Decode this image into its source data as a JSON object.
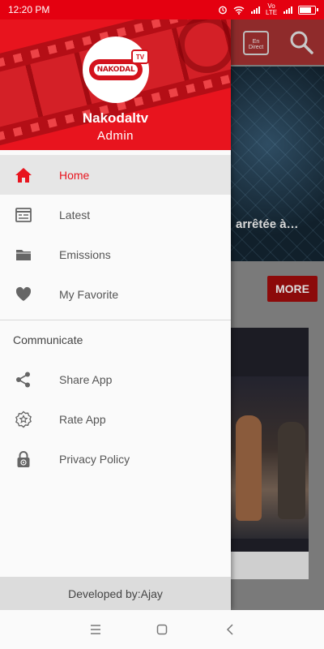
{
  "status_bar": {
    "time": "12:20 PM",
    "network_labels": "Vo LTE"
  },
  "drawer": {
    "header": {
      "logo_text": "NAKODAL",
      "logo_badge": "TV",
      "user_name": "Nakodaltv",
      "user_role": "Admin"
    },
    "items": [
      {
        "label": "Home",
        "icon": "home-icon",
        "active": true
      },
      {
        "label": "Latest",
        "icon": "calendar-icon",
        "active": false
      },
      {
        "label": "Emissions",
        "icon": "folder-icon",
        "active": false
      },
      {
        "label": "My Favorite",
        "icon": "heart-icon",
        "active": false
      }
    ],
    "section_title": "Communicate",
    "communicate_items": [
      {
        "label": "Share App",
        "icon": "share-icon"
      },
      {
        "label": "Rate App",
        "icon": "star-badge-icon"
      },
      {
        "label": "Privacy Policy",
        "icon": "lock-icon"
      }
    ],
    "footer": "Developed by:Ajay"
  },
  "background_app": {
    "live_icon_text": "En Direct",
    "banner_caption": "arrêtée à…",
    "more_button": "MORE"
  },
  "colors": {
    "accent": "#e8141e",
    "status_bar": "#e40010",
    "active_row": "#e6e6e6"
  }
}
